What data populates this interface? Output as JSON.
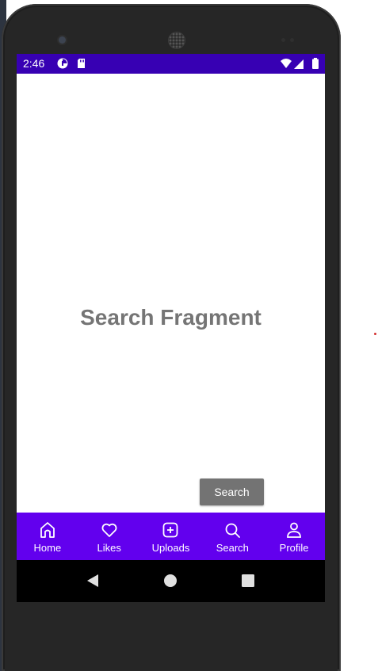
{
  "status_bar": {
    "time": "2:46",
    "icons": [
      "data-saver-icon",
      "sd-card-icon",
      "wifi-icon",
      "signal-icon",
      "battery-icon"
    ],
    "background": "#3700b3"
  },
  "content": {
    "title": "Search Fragment",
    "search_button_label": "Search"
  },
  "bottom_nav": {
    "background": "#6200ee",
    "items": [
      {
        "label": "Home",
        "icon": "home-icon"
      },
      {
        "label": "Likes",
        "icon": "heart-icon"
      },
      {
        "label": "Uploads",
        "icon": "add-box-icon"
      },
      {
        "label": "Search",
        "icon": "search-icon"
      },
      {
        "label": "Profile",
        "icon": "person-icon"
      }
    ]
  },
  "system_nav": {
    "buttons": [
      "back-icon",
      "home-circle-icon",
      "recents-icon"
    ]
  }
}
